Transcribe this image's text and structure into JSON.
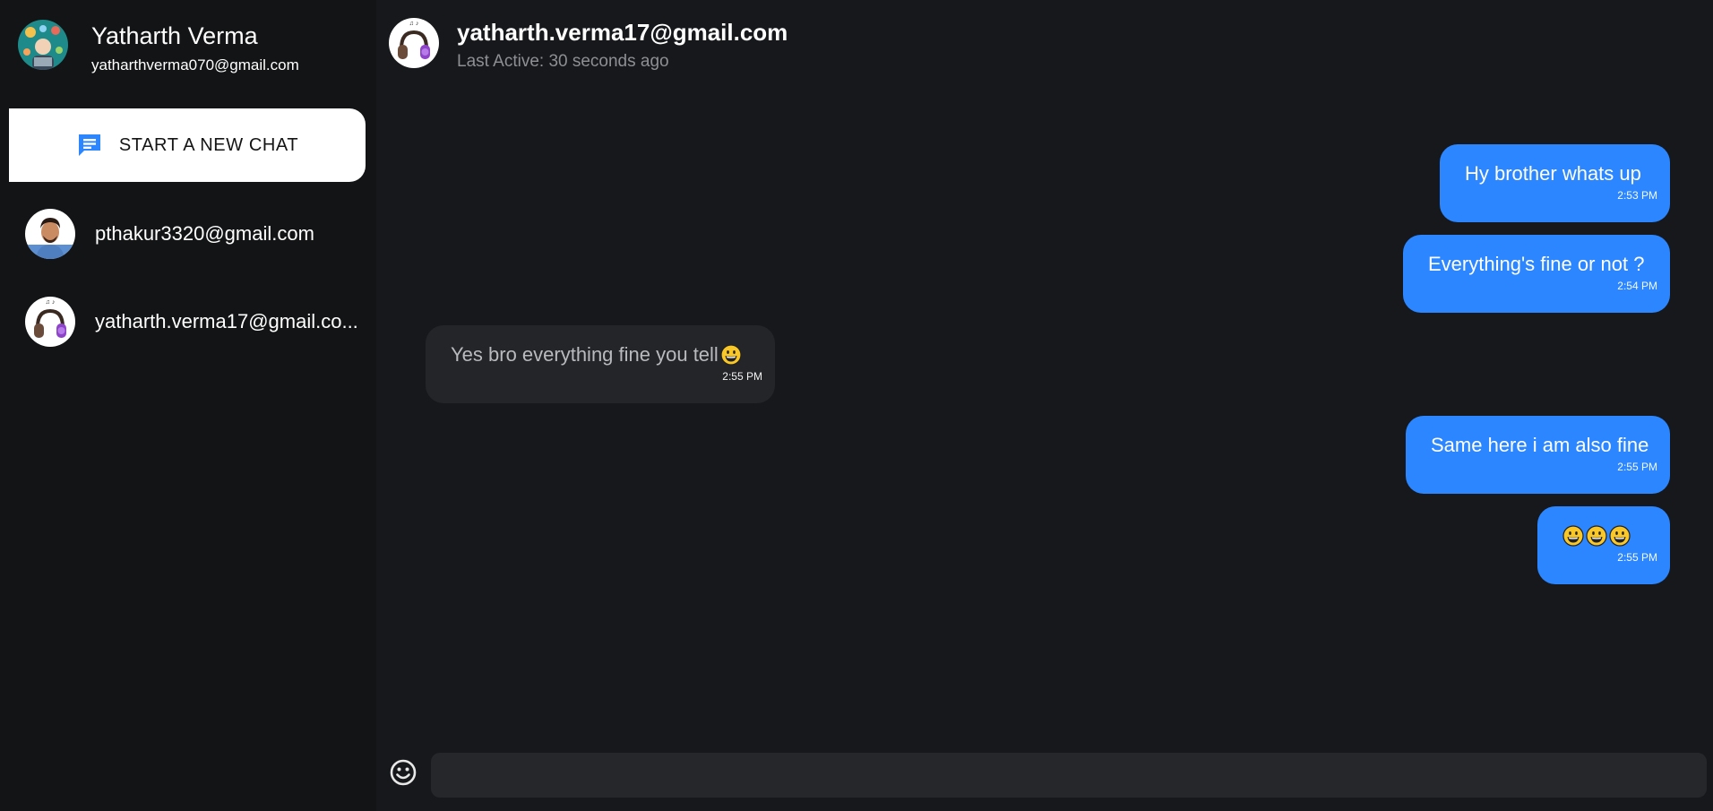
{
  "user": {
    "name": "Yatharth Verma",
    "email": "yatharthverma070@gmail.com",
    "avatar_icon": "user-avatar-illustration"
  },
  "sidebar": {
    "new_chat_label": "START A NEW CHAT",
    "new_chat_icon": "chat-bubble-icon",
    "contacts": [
      {
        "name": "pthakur3320@gmail.com",
        "avatar_icon": "person-photo-avatar"
      },
      {
        "name": "yatharth.verma17@gmail.co...",
        "avatar_icon": "headphones-avatar"
      }
    ]
  },
  "chat": {
    "title": "yatharth.verma17@gmail.com",
    "last_active": "Last Active: 30 seconds ago",
    "messages": [
      {
        "dir": "sent",
        "text": "Hy brother whats up",
        "time": "2:53 PM"
      },
      {
        "dir": "sent",
        "text": "Everything's fine or not ?",
        "time": "2:54 PM"
      },
      {
        "dir": "recv",
        "text": "Yes bro everything fine you tell",
        "time": "2:55 PM",
        "emoji": "grinning-face"
      },
      {
        "dir": "sent",
        "text": "Same here i am also fine",
        "time": "2:55 PM"
      },
      {
        "dir": "sent",
        "text": "",
        "time": "2:55 PM",
        "emoji_count": 3,
        "emoji": "grinning-face"
      }
    ]
  },
  "composer": {
    "placeholder": "",
    "emoji_icon": "smiley-icon"
  },
  "colors": {
    "sent_bubble": "#2b86ff",
    "recv_bubble": "#242529",
    "background": "#17181b",
    "sidebar": "#131416",
    "accent_icon": "#2b86ff"
  }
}
